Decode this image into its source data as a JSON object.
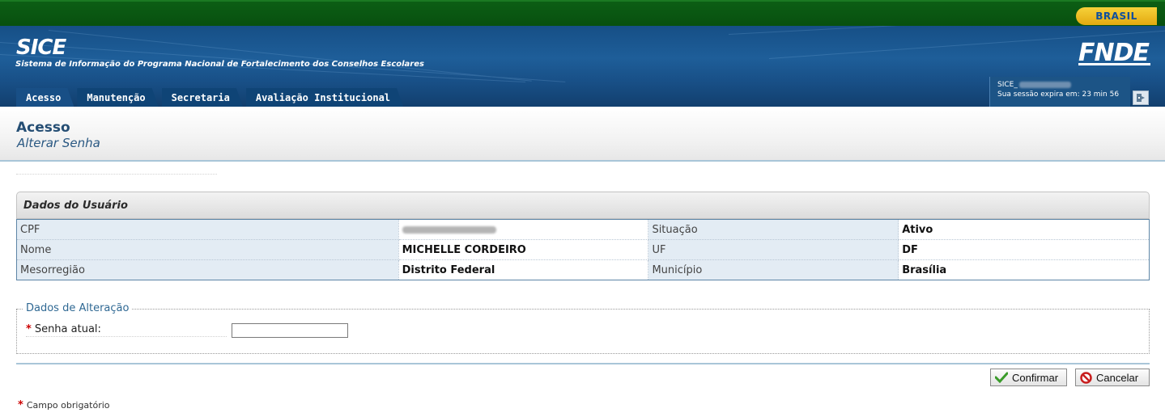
{
  "gov_bar": {
    "badge": "BRASIL"
  },
  "header": {
    "system_name": "SICE",
    "system_description": "Sistema de Informação do Programa Nacional de Fortalecimento dos Conselhos Escolares",
    "logo": "FNDE"
  },
  "nav": {
    "tabs": [
      "Acesso",
      "Manutenção",
      "Secretaria",
      "Avaliação Institucional"
    ]
  },
  "session": {
    "user_prefix": "SICE_",
    "expire_text": "Sua sessão expira em: 23 min 56"
  },
  "page": {
    "title": "Acesso",
    "subtitle": "Alterar Senha"
  },
  "user_panel": {
    "title": "Dados do Usuário",
    "rows": [
      {
        "label1": "CPF",
        "value1": "",
        "label2": "Situação",
        "value2": "Ativo"
      },
      {
        "label1": "Nome",
        "value1": "MICHELLE CORDEIRO",
        "label2": "UF",
        "value2": "DF"
      },
      {
        "label1": "Mesorregião",
        "value1": "Distrito Federal",
        "label2": "Município",
        "value2": "Brasília"
      }
    ]
  },
  "alteracao": {
    "legend": "Dados de Alteração",
    "senha_label": "Senha atual:",
    "senha_value": ""
  },
  "buttons": {
    "confirm": "Confirmar",
    "cancel": "Cancelar"
  },
  "footnote": "Campo obrigatório",
  "required_marker": "*",
  "colors": {
    "gov_green": "#08500f",
    "header_blue": "#1e5e99",
    "title_blue": "#254e74",
    "required_red": "#cc0000"
  }
}
